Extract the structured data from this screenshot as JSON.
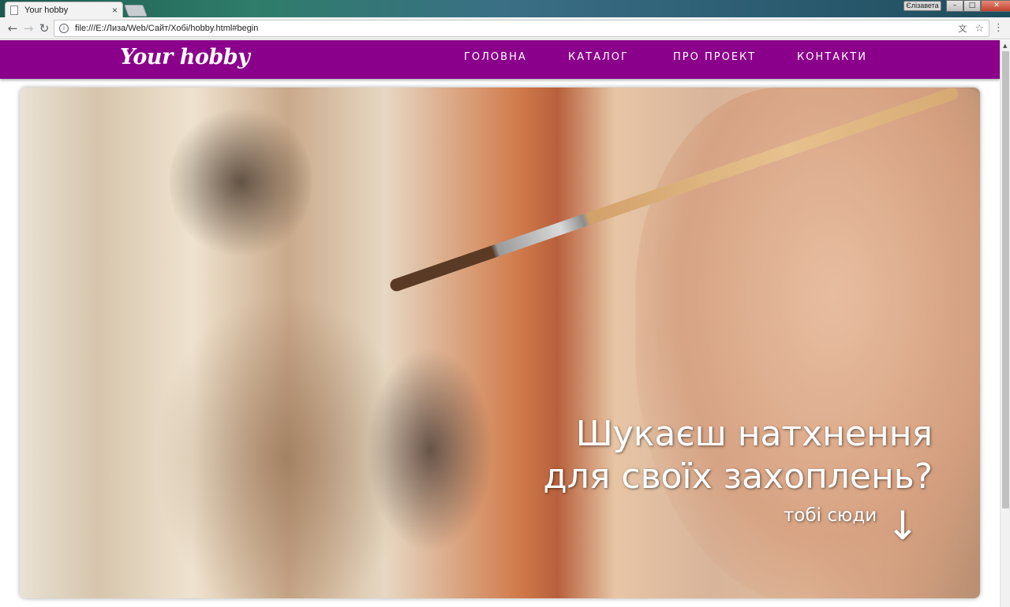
{
  "browser": {
    "tab_title": "Your hobby",
    "tab_close": "×",
    "profile_label": "Єлізавета",
    "window_buttons": [
      "–",
      "□",
      "✕"
    ],
    "url": "file:///E:/Лиза/Web/Сайт/Хобі/hobby.html#begin",
    "nav_back": "←",
    "nav_forward": "→",
    "nav_reload": "↻",
    "info_icon": "i",
    "translate_icon": "文",
    "star_icon": "☆",
    "menu_icon": "⋮"
  },
  "site": {
    "logo": "Your hobby",
    "brand_color": "#8b008b",
    "nav": [
      "ГОЛОВНА",
      "КАТАЛОГ",
      "ПРО ПРОЕКТ",
      "КОНТАКТИ"
    ]
  },
  "hero": {
    "headline_line1": "Шукаєш натхнення",
    "headline_line2": "для своїх захоплень?",
    "cta_text": "тобі сюди",
    "cta_arrow": "↓"
  }
}
